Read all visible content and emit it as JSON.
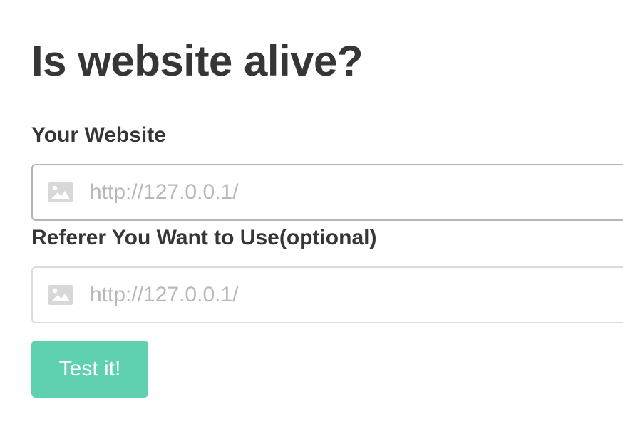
{
  "page": {
    "title": "Is website alive?"
  },
  "form": {
    "website": {
      "label": "Your Website",
      "placeholder": "http://127.0.0.1/",
      "value": "",
      "icon": "image-icon"
    },
    "referer": {
      "label": "Referer You Want to Use(optional)",
      "placeholder": "http://127.0.0.1/",
      "value": "",
      "icon": "image-icon"
    },
    "submit_label": "Test it!"
  },
  "colors": {
    "text": "#363636",
    "placeholder": "#b8b8b8",
    "accent": "#5fd0b0",
    "border_active": "#b5b5b5",
    "border": "#dbdbdb",
    "icon": "#d8d8d8"
  }
}
